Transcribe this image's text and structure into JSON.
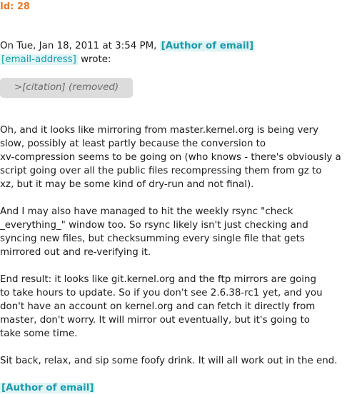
{
  "meta": {
    "id_label": "Id: 28"
  },
  "header": {
    "intro": "On Tue, Jan 18, 2011 at 3:54 PM, ",
    "author_tag": "[Author of email]",
    "email_tag": "[email-address]",
    "wrote": " wrote:"
  },
  "citation": {
    "text": ">[citation] (removed)"
  },
  "body": {
    "paragraphs": [
      [
        "Oh, and it looks like mirroring from master.kernel.org is being very",
        "slow, possibly at least partly because the conversion to",
        "xv-compression seems to be going on (who knows - there's obviously a",
        "script going over all the public files recompressing them from gz to",
        "xz, but it may be some kind of dry-run and not final)."
      ],
      [
        "And I may also have managed to hit the weekly rsync \"check",
        "_everything_\" window too. So rsync likely isn't just checking and",
        "syncing new files, but checksumming every single file that gets",
        "mirrored out and re-verifying it."
      ],
      [
        "End result: it looks like git.kernel.org and the ftp mirrors are going",
        "to take hours to update. So if you don't see 2.6.38-rc1 yet, and you",
        "don't have an account on kernel.org and can fetch it directly from",
        "master, don't worry. It will mirror out eventually, but it's going to",
        "take some time."
      ],
      [
        "Sit back, relax, and sip some foofy drink. It will all work out in the end."
      ]
    ]
  },
  "signature": {
    "author_tag": "[Author of email]"
  }
}
